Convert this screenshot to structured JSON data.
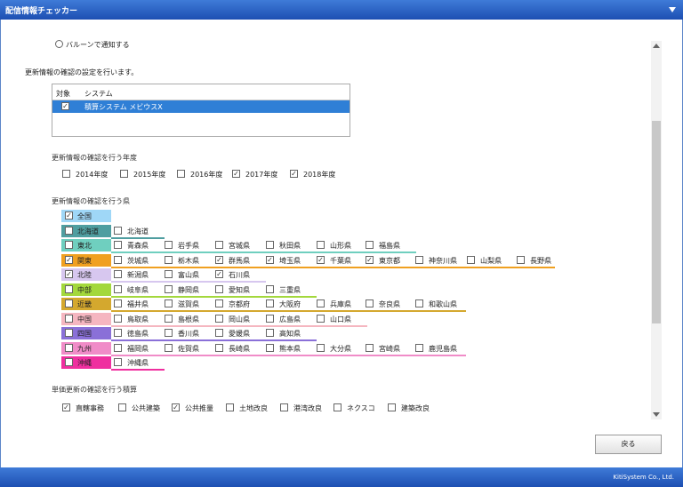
{
  "window": {
    "title": "配信情報チェッカー"
  },
  "balloon": {
    "label": "バルーンで通知する"
  },
  "intro": "更新情報の確認の設定を行います。",
  "list": {
    "headers": [
      "対象",
      "システム"
    ],
    "rows": [
      {
        "checked": true,
        "name": "積算システム メビウスX"
      }
    ]
  },
  "years": {
    "title": "更新情報の確認を行う年度",
    "items": [
      {
        "label": "2014年度",
        "checked": false
      },
      {
        "label": "2015年度",
        "checked": false
      },
      {
        "label": "2016年度",
        "checked": false
      },
      {
        "label": "2017年度",
        "checked": true
      },
      {
        "label": "2018年度",
        "checked": true
      }
    ]
  },
  "prefs_title": "更新情報の確認を行う県",
  "regions": [
    {
      "name": "全国",
      "color": "#9fd7f7",
      "checked": true,
      "prefs": []
    },
    {
      "name": "北海道",
      "color": "#4f9ea0",
      "checked": false,
      "prefs": [
        {
          "label": "北海道",
          "checked": false
        }
      ]
    },
    {
      "name": "東北",
      "color": "#6fcfbf",
      "checked": false,
      "prefs": [
        {
          "label": "青森県",
          "checked": false
        },
        {
          "label": "岩手県",
          "checked": false
        },
        {
          "label": "宮城県",
          "checked": false
        },
        {
          "label": "秋田県",
          "checked": false
        },
        {
          "label": "山形県",
          "checked": false
        },
        {
          "label": "福島県",
          "checked": false
        }
      ]
    },
    {
      "name": "関東",
      "color": "#f0a020",
      "checked": true,
      "prefs": [
        {
          "label": "茨城県",
          "checked": false
        },
        {
          "label": "栃木県",
          "checked": false
        },
        {
          "label": "群馬県",
          "checked": true
        },
        {
          "label": "埼玉県",
          "checked": true
        },
        {
          "label": "千葉県",
          "checked": true
        },
        {
          "label": "東京都",
          "checked": true
        },
        {
          "label": "神奈川県",
          "checked": false
        },
        {
          "label": "山梨県",
          "checked": false
        },
        {
          "label": "長野県",
          "checked": false
        }
      ]
    },
    {
      "name": "北陸",
      "color": "#d7c7ef",
      "checked": true,
      "prefs": [
        {
          "label": "新潟県",
          "checked": false
        },
        {
          "label": "富山県",
          "checked": false
        },
        {
          "label": "石川県",
          "checked": true
        }
      ]
    },
    {
      "name": "中部",
      "color": "#a3d83c",
      "checked": false,
      "prefs": [
        {
          "label": "岐阜県",
          "checked": false
        },
        {
          "label": "静岡県",
          "checked": false
        },
        {
          "label": "愛知県",
          "checked": false
        },
        {
          "label": "三重県",
          "checked": false
        }
      ]
    },
    {
      "name": "近畿",
      "color": "#d4a82e",
      "checked": false,
      "prefs": [
        {
          "label": "福井県",
          "checked": false
        },
        {
          "label": "滋賀県",
          "checked": false
        },
        {
          "label": "京都府",
          "checked": false
        },
        {
          "label": "大阪府",
          "checked": false
        },
        {
          "label": "兵庫県",
          "checked": false
        },
        {
          "label": "奈良県",
          "checked": false
        },
        {
          "label": "和歌山県",
          "checked": false
        }
      ]
    },
    {
      "name": "中国",
      "color": "#f5b6c0",
      "checked": false,
      "prefs": [
        {
          "label": "鳥取県",
          "checked": false
        },
        {
          "label": "島根県",
          "checked": false
        },
        {
          "label": "岡山県",
          "checked": false
        },
        {
          "label": "広島県",
          "checked": false
        },
        {
          "label": "山口県",
          "checked": false
        }
      ]
    },
    {
      "name": "四国",
      "color": "#8a70d8",
      "checked": false,
      "prefs": [
        {
          "label": "徳島県",
          "checked": false
        },
        {
          "label": "香川県",
          "checked": false
        },
        {
          "label": "愛媛県",
          "checked": false
        },
        {
          "label": "高知県",
          "checked": false
        }
      ]
    },
    {
      "name": "九州",
      "color": "#f08cc8",
      "checked": false,
      "prefs": [
        {
          "label": "福岡県",
          "checked": false
        },
        {
          "label": "佐賀県",
          "checked": false
        },
        {
          "label": "長崎県",
          "checked": false
        },
        {
          "label": "熊本県",
          "checked": false
        },
        {
          "label": "大分県",
          "checked": false
        },
        {
          "label": "宮崎県",
          "checked": false
        },
        {
          "label": "鹿児島県",
          "checked": false
        }
      ]
    },
    {
      "name": "沖縄",
      "color": "#ef2f9f",
      "checked": false,
      "prefs": [
        {
          "label": "沖縄県",
          "checked": false
        }
      ]
    }
  ],
  "types": {
    "title": "単価更新の確認を行う積算",
    "items": [
      {
        "label": "直轄事務",
        "checked": true
      },
      {
        "label": "公共建築",
        "checked": false
      },
      {
        "label": "公共推量",
        "checked": true
      },
      {
        "label": "土地改良",
        "checked": false
      },
      {
        "label": "港湾改良",
        "checked": false
      },
      {
        "label": "ネクスコ",
        "checked": false
      },
      {
        "label": "建築改良",
        "checked": false
      }
    ]
  },
  "close_button": "戻る",
  "footer": "KitiSystem Co., Ltd."
}
